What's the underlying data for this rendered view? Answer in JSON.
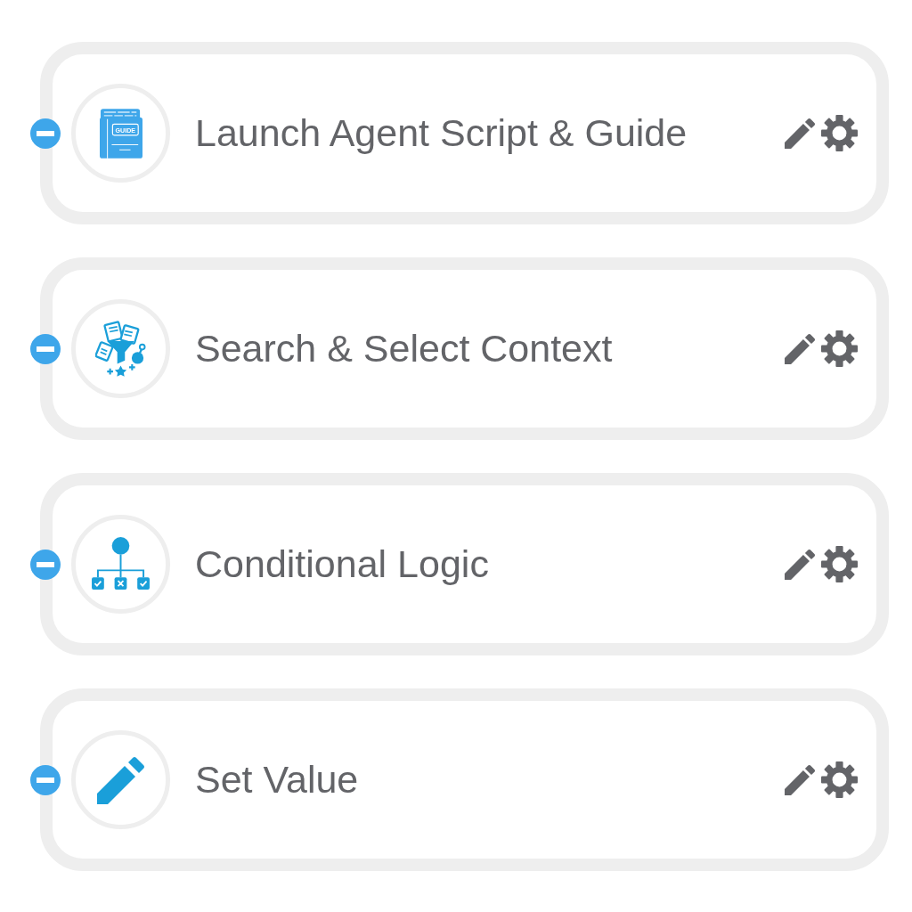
{
  "items": [
    {
      "kind": "guide",
      "title": "Launch Agent Script & Guide",
      "icon_text": "GUIDE",
      "expanded": true
    },
    {
      "kind": "funnel",
      "title": "Search & Select Context",
      "expanded": true
    },
    {
      "kind": "hierarchy",
      "title": "Conditional Logic",
      "expanded": true
    },
    {
      "kind": "pencil",
      "title": "Set Value",
      "expanded": true
    }
  ]
}
